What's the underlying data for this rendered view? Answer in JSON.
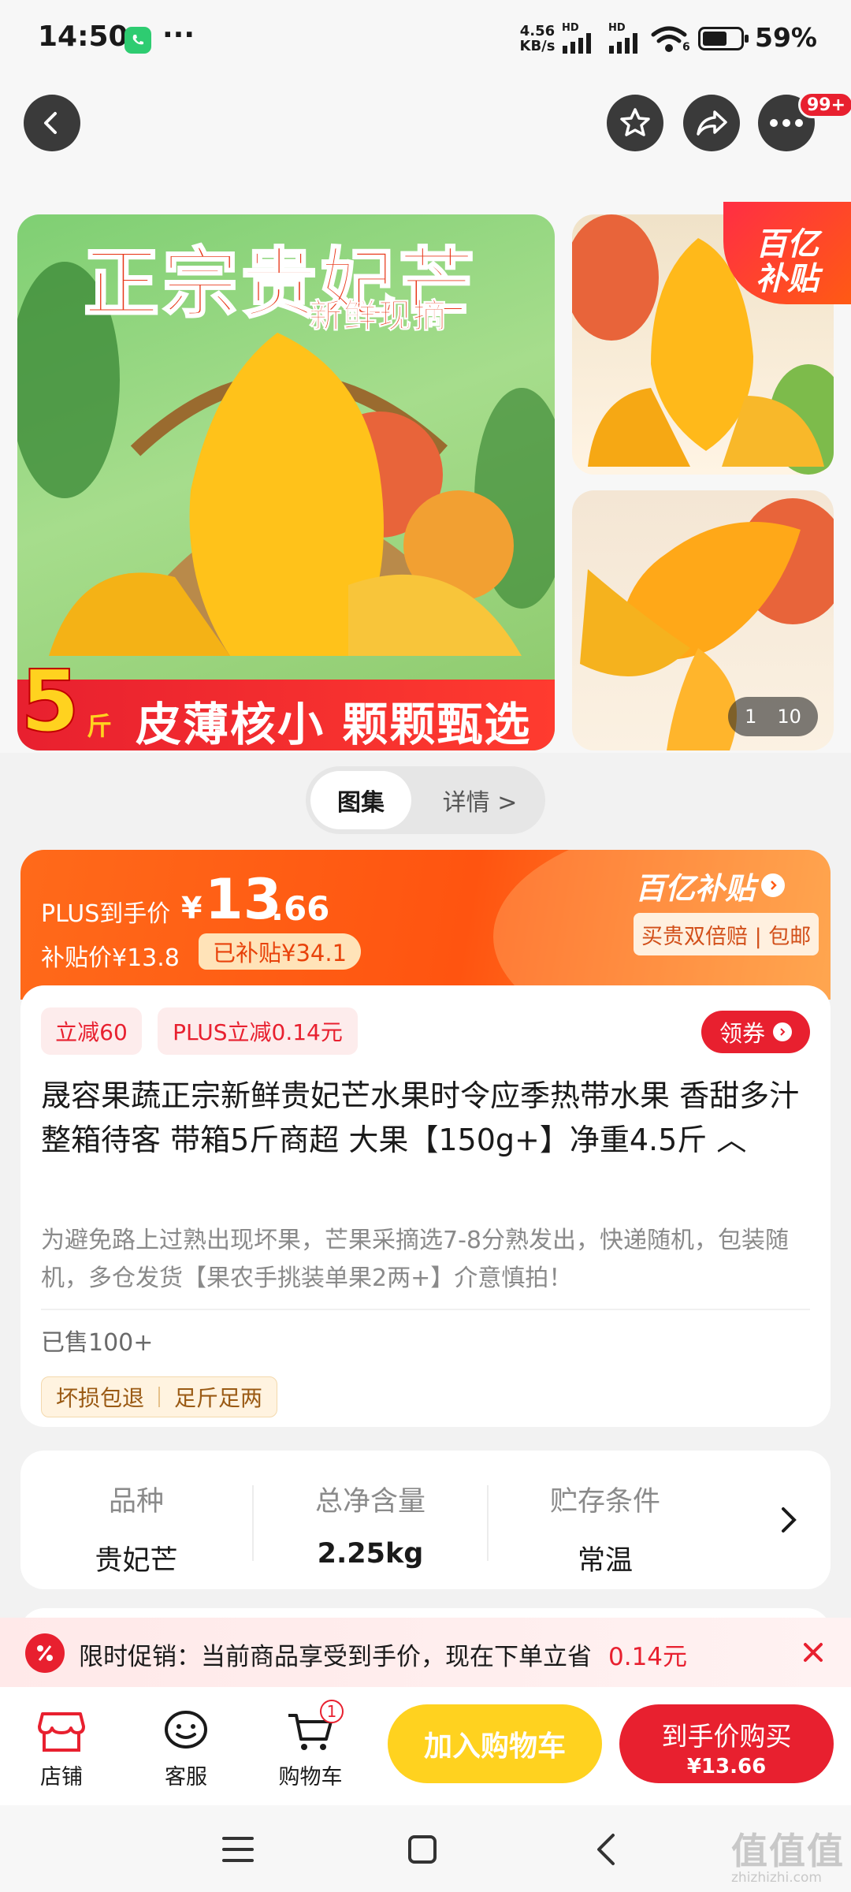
{
  "status_bar": {
    "time": "14:50",
    "more": "···",
    "speed_value": "4.56",
    "speed_unit": "KB/s",
    "hd1": "HD",
    "hd2": "HD",
    "wifi_sub": "6",
    "battery_pct": "59%"
  },
  "header": {
    "badge": "99+"
  },
  "gallery": {
    "main_title": "正宗贵妃芒",
    "main_subtitle": "新鲜现摘",
    "weight_number": "5",
    "weight_unit": "斤",
    "main_banner": "皮薄核小 颗颗甄选",
    "brand_badge_line1": "百亿",
    "brand_badge_line2": "补贴",
    "page_indicator_current": "1",
    "page_indicator_total": "10"
  },
  "view_toggle": {
    "gallery_label": "图集",
    "details_label": "详情 >"
  },
  "price": {
    "plus_label": "PLUS到手价",
    "currency": "¥",
    "integer": "13",
    "decimal": ".66",
    "subsidy_price": "补贴价¥13.8",
    "subsidized": "已补贴¥34.1",
    "brand": "百亿补贴",
    "guarantee": "买贵双倍赔 | 包邮"
  },
  "product": {
    "coupon1": "立减60",
    "coupon2": "PLUS立减0.14元",
    "coupon_button": "领券",
    "title": "晟容果蔬正宗新鲜贵妃芒水果时令应季热带水果 香甜多汁 整箱待客 带箱5斤商超 大果【150g+】净重4.5斤 ︿",
    "note": "为避免路上过熟出现坏果，芒果采摘选7-8分熟发出，快递随机，包装随机，多仓发货【果农手挑装单果2两+】介意慎拍！",
    "sold": "已售100+",
    "tag1": "坏损包退",
    "tag2": "足斤足两"
  },
  "specs": [
    {
      "label": "品种",
      "value": "贵妃芒"
    },
    {
      "label": "总净含量",
      "value": "2.25kg"
    },
    {
      "label": "贮存条件",
      "value": "常温"
    }
  ],
  "promo": {
    "text": "限时促销：当前商品享受到手价，现在下单立省",
    "amount": "0.14元"
  },
  "bottom_bar": {
    "shop": "店铺",
    "service": "客服",
    "cart": "购物车",
    "cart_count": "1",
    "add_to_cart": "加入购物车",
    "buy_label": "到手价购买",
    "buy_price": "¥13.66"
  },
  "watermark": {
    "logo": "值值值",
    "site": "zhizhizhi.com"
  },
  "colors": {
    "accent_red": "#e8202f",
    "accent_orange": "#ff5a14",
    "cart_yellow": "#ffd21f"
  }
}
